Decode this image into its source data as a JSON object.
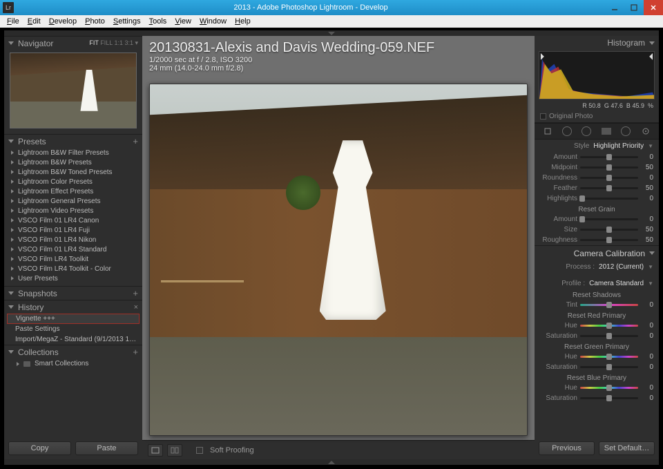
{
  "window": {
    "title": "2013 - Adobe Photoshop Lightroom - Develop",
    "lr_icon": "Lr"
  },
  "menu": [
    "File",
    "Edit",
    "Develop",
    "Photo",
    "Settings",
    "Tools",
    "View",
    "Window",
    "Help"
  ],
  "navigator": {
    "title": "Navigator",
    "opts": [
      "FIT",
      "FILL",
      "1:1",
      "3:1"
    ],
    "active_opt": "FIT"
  },
  "presets": {
    "title": "Presets",
    "items": [
      "Lightroom B&W Filter Presets",
      "Lightroom B&W Presets",
      "Lightroom B&W Toned Presets",
      "Lightroom Color Presets",
      "Lightroom Effect Presets",
      "Lightroom General Presets",
      "Lightroom Video Presets",
      "VSCO Film 01 LR4 Canon",
      "VSCO Film 01 LR4 Fuji",
      "VSCO Film 01 LR4 Nikon",
      "VSCO Film 01 LR4 Standard",
      "VSCO Film LR4 Toolkit",
      "VSCO Film LR4 Toolkit - Color",
      "User Presets"
    ]
  },
  "snapshots": {
    "title": "Snapshots"
  },
  "history": {
    "title": "History",
    "items": [
      {
        "label": "Vignette +++",
        "selected": true
      },
      {
        "label": "Paste Settings",
        "selected": false
      },
      {
        "label": "Import/MegaZ - Standard (9/1/2013 1…",
        "selected": false
      }
    ]
  },
  "collections": {
    "title": "Collections",
    "smart": "Smart Collections"
  },
  "left_buttons": {
    "copy": "Copy",
    "paste": "Paste"
  },
  "image": {
    "filename": "20130831-Alexis and Davis Wedding-059.NEF",
    "exif1": "1/2000 sec at f / 2.8, ISO 3200",
    "exif2": "24 mm (14.0-24.0 mm f/2.8)"
  },
  "toolbar": {
    "soft_proof": "Soft Proofing"
  },
  "right": {
    "hist_title": "Histogram",
    "hist_stats": {
      "r_lbl": "R",
      "r": "50.8",
      "g_lbl": "G",
      "g": "47.6",
      "b_lbl": "B",
      "b": "45.9",
      "pct": "%"
    },
    "orig": "Original Photo",
    "vignette": {
      "style_lbl": "Style",
      "style_val": "Highlight Priority",
      "sliders": [
        {
          "lbl": "Amount",
          "val": "0",
          "pos": 50
        },
        {
          "lbl": "Midpoint",
          "val": "50",
          "pos": 50
        },
        {
          "lbl": "Roundness",
          "val": "0",
          "pos": 50
        },
        {
          "lbl": "Feather",
          "val": "50",
          "pos": 50
        },
        {
          "lbl": "Highlights",
          "val": "0",
          "pos": 3
        }
      ]
    },
    "grain": {
      "title": "Reset Grain",
      "sliders": [
        {
          "lbl": "Amount",
          "val": "0",
          "pos": 3
        },
        {
          "lbl": "Size",
          "val": "50",
          "pos": 50
        },
        {
          "lbl": "Roughness",
          "val": "50",
          "pos": 50
        }
      ]
    },
    "cc": {
      "title": "Camera Calibration",
      "process_lbl": "Process :",
      "process_val": "2012 (Current)",
      "profile_lbl": "Profile :",
      "profile_val": "Camera Standard",
      "groups": [
        {
          "title": "Reset Shadows",
          "sliders": [
            {
              "lbl": "Tint",
              "val": "0",
              "pos": 50,
              "tint": true
            }
          ]
        },
        {
          "title": "Reset Red Primary",
          "sliders": [
            {
              "lbl": "Hue",
              "val": "0",
              "pos": 50,
              "hue": true
            },
            {
              "lbl": "Saturation",
              "val": "0",
              "pos": 50
            }
          ]
        },
        {
          "title": "Reset Green Primary",
          "sliders": [
            {
              "lbl": "Hue",
              "val": "0",
              "pos": 50,
              "hue": true
            },
            {
              "lbl": "Saturation",
              "val": "0",
              "pos": 50
            }
          ]
        },
        {
          "title": "Reset Blue Primary",
          "sliders": [
            {
              "lbl": "Hue",
              "val": "0",
              "pos": 50,
              "hue": true
            },
            {
              "lbl": "Saturation",
              "val": "0",
              "pos": 50
            }
          ]
        }
      ]
    },
    "buttons": {
      "prev": "Previous",
      "reset": "Set Default…"
    }
  }
}
